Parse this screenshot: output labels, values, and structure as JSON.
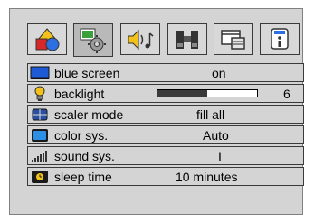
{
  "tabs": [
    {
      "icon": "shapes-icon",
      "active": false
    },
    {
      "icon": "settings-gear-icon",
      "active": true
    },
    {
      "icon": "speaker-music-icon",
      "active": false
    },
    {
      "icon": "binoculars-icon",
      "active": false
    },
    {
      "icon": "display-window-icon",
      "active": false
    },
    {
      "icon": "info-icon",
      "active": false
    }
  ],
  "menu": [
    {
      "label": "blue screen",
      "value": "on",
      "icon": "blue-screen-icon"
    },
    {
      "label": "backlight",
      "value": "6",
      "icon": "lightbulb-icon",
      "level": 0.5
    },
    {
      "label": "scaler mode",
      "value": "fill all",
      "icon": "scaler-icon"
    },
    {
      "label": "color sys.",
      "value": "Auto",
      "icon": "color-tv-icon"
    },
    {
      "label": "sound sys.",
      "value": "I",
      "icon": "signal-bars-icon"
    },
    {
      "label": "sleep time",
      "value": "10 minutes",
      "icon": "sleep-timer-icon"
    }
  ],
  "colors": {
    "panel": "#d4d4d4",
    "blue": "#1e5ad6",
    "yellow": "#f2c21b"
  }
}
